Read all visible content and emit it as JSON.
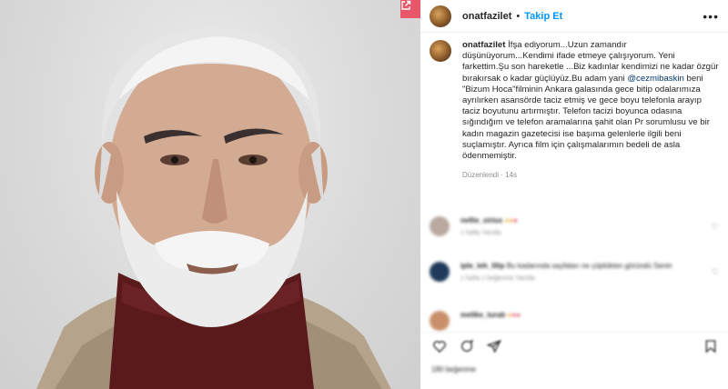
{
  "post": {
    "username": "onatfazilet",
    "separator": "•",
    "follow_label": "Takip Et",
    "more_icon": "more-horizontal-icon",
    "expand_icon": "external-link-icon"
  },
  "caption": {
    "username": "onatfazilet",
    "text_before": " İfşa ediyorum...Uzun zamandır düşünüyorum...Kendimi ifade etmeye çalışıyorum. Yeni farkettim.Şu son hareketle ...Biz kadınlar kendimizi ne kadar özgür bırakırsak o kadar güçlüyüz.Bu adam yani ",
    "mention": "@cezmibaskin",
    "text_after": " beni \"Bizum Hoca\"filminin Ankara galasında gece bitip odalarımıza ayrılırken asansörde taciz etmiş ve gece boyu telefonla arayıp taciz boyutunu artırmıştır. Telefon tacizi boyunca odasına sığındığım ve telefon aramalarına şahit olan Pr sorumlusu ve bir kadın magazin gazetecisi ise başıma gelenlerle ilgili beni suçlamıştır. Ayrıca film için çalışmalarımın bedeli de asla ödenmemiştir.",
    "edited_label": "Düzenlendi · 14s"
  },
  "comments": [
    {
      "name": "nellie_siriux",
      "text": "",
      "meta": "1 hafta  Yanıtla",
      "avatar_color": "#b9a9a0"
    },
    {
      "name": "iple_leh_liltp",
      "text": "Bu kadarında sayfaları ne çöplükten göründü Senin",
      "meta": "1 hafta  1 beğenme  Yanıtla",
      "avatar_color": "#1f3a5a"
    },
    {
      "name": "melike_turab",
      "text": "",
      "meta": "",
      "avatar_color": "#c98f6b"
    }
  ],
  "actions": {
    "like_icon": "heart-icon",
    "comment_icon": "comment-icon",
    "share_icon": "share-icon",
    "save_icon": "bookmark-icon"
  },
  "likes_label": "180 beğenme",
  "colors": {
    "accent": "#0095f6",
    "mention": "#00376b",
    "expand_button": "#e8566a"
  }
}
